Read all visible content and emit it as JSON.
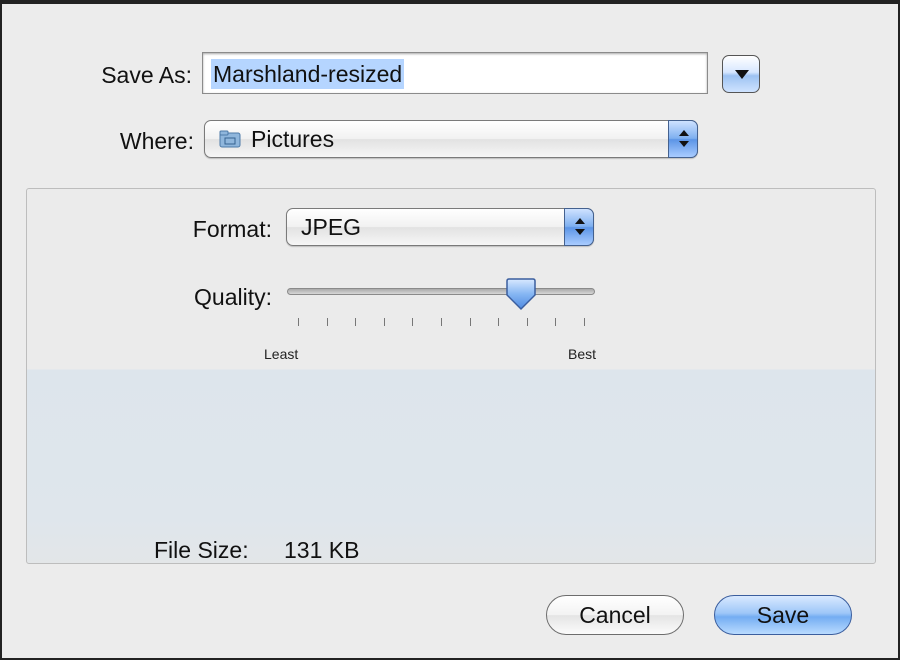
{
  "save_as": {
    "label": "Save As:",
    "value": "Marshland-resized"
  },
  "where": {
    "label": "Where:",
    "value": "Pictures",
    "icon": "folder-icon"
  },
  "format": {
    "label": "Format:",
    "value": "JPEG"
  },
  "quality": {
    "label": "Quality:",
    "min_label": "Least",
    "max_label": "Best",
    "level": 0.78,
    "tick_count": 11
  },
  "file_size": {
    "label": "File Size:",
    "value": "131 KB"
  },
  "buttons": {
    "cancel": "Cancel",
    "save": "Save"
  },
  "colors": {
    "selection": "#b5d5ff",
    "accent": "#74adf2"
  }
}
